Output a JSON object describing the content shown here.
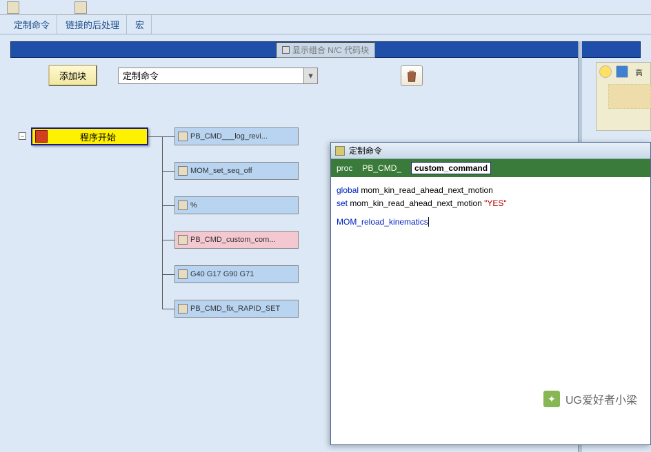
{
  "tabs": {
    "t1": "定制命令",
    "t2": "链接的后处理",
    "t3": "宏"
  },
  "checkbox_label": "显示组合 N/C 代码块",
  "add_button": "添加块",
  "combo_value": "定制命令",
  "start_node": "程序开始",
  "blocks": {
    "b1": "PB_CMD___log_revi...",
    "b2": "MOM_set_seq_off",
    "b3": "%",
    "b4": "PB_CMD_custom_com...",
    "b5": "G40 G17 G90 G71",
    "b6": "PB_CMD_fix_RAPID_SET"
  },
  "editor": {
    "title": "定制命令",
    "proc_kw": "proc",
    "prefix": "PB_CMD_",
    "name": "custom_command",
    "code": {
      "l1a": "global",
      "l1b": " mom_kin_read_ahead_next_motion",
      "l2a": "set",
      "l2b": " mom_kin_read_ahead_next_motion        ",
      "l2c": "\"YES\"",
      "l3": "MOM_reload_kinematics"
    }
  },
  "side_text": "高",
  "watermark": "UG爱好者小梁"
}
